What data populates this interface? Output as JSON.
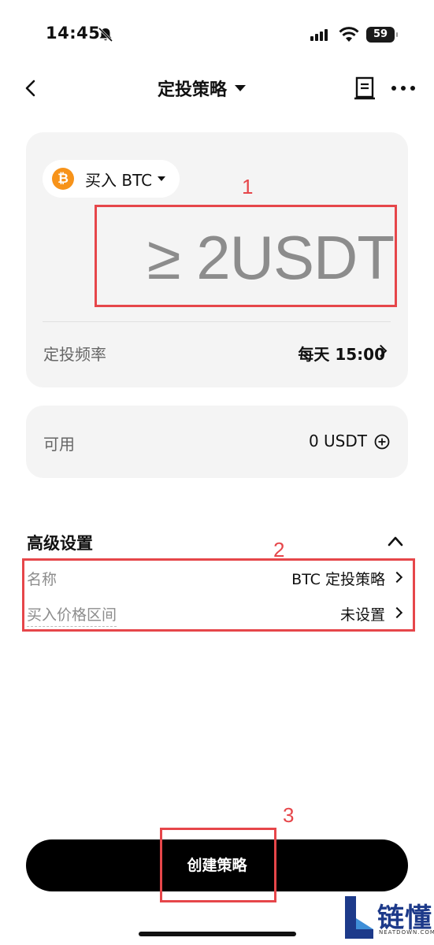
{
  "status_bar": {
    "time": "14:45",
    "battery": "59",
    "icons": [
      "bell-slash-icon",
      "signal-icon",
      "wifi-icon",
      "battery-icon"
    ]
  },
  "nav": {
    "title": "定投策略",
    "icons": [
      "back-icon",
      "caret-down-icon",
      "document-icon",
      "more-icon"
    ]
  },
  "main_card": {
    "coin": "买入 BTC",
    "coin_icon": "₿",
    "amount_placeholder": "≥ 2USDT",
    "frequency_label": "定投频率",
    "frequency_value": "每天 15:00"
  },
  "available": {
    "label": "可用",
    "value": "0 USDT"
  },
  "advanced": {
    "title": "高级设置",
    "name_label": "名称",
    "name_value": "BTC 定投策略",
    "price_range_label": "买入价格区间",
    "price_range_value": "未设置"
  },
  "create_button": "创建策略",
  "annotations": [
    "1",
    "2",
    "3"
  ],
  "watermark": {
    "text": "链懂",
    "sub": "NEATDOWN.COM"
  },
  "colors": {
    "annotation": "#e6464a",
    "btc": "#f7931a",
    "card_bg": "#f4f4f4",
    "button_bg": "#000000"
  }
}
